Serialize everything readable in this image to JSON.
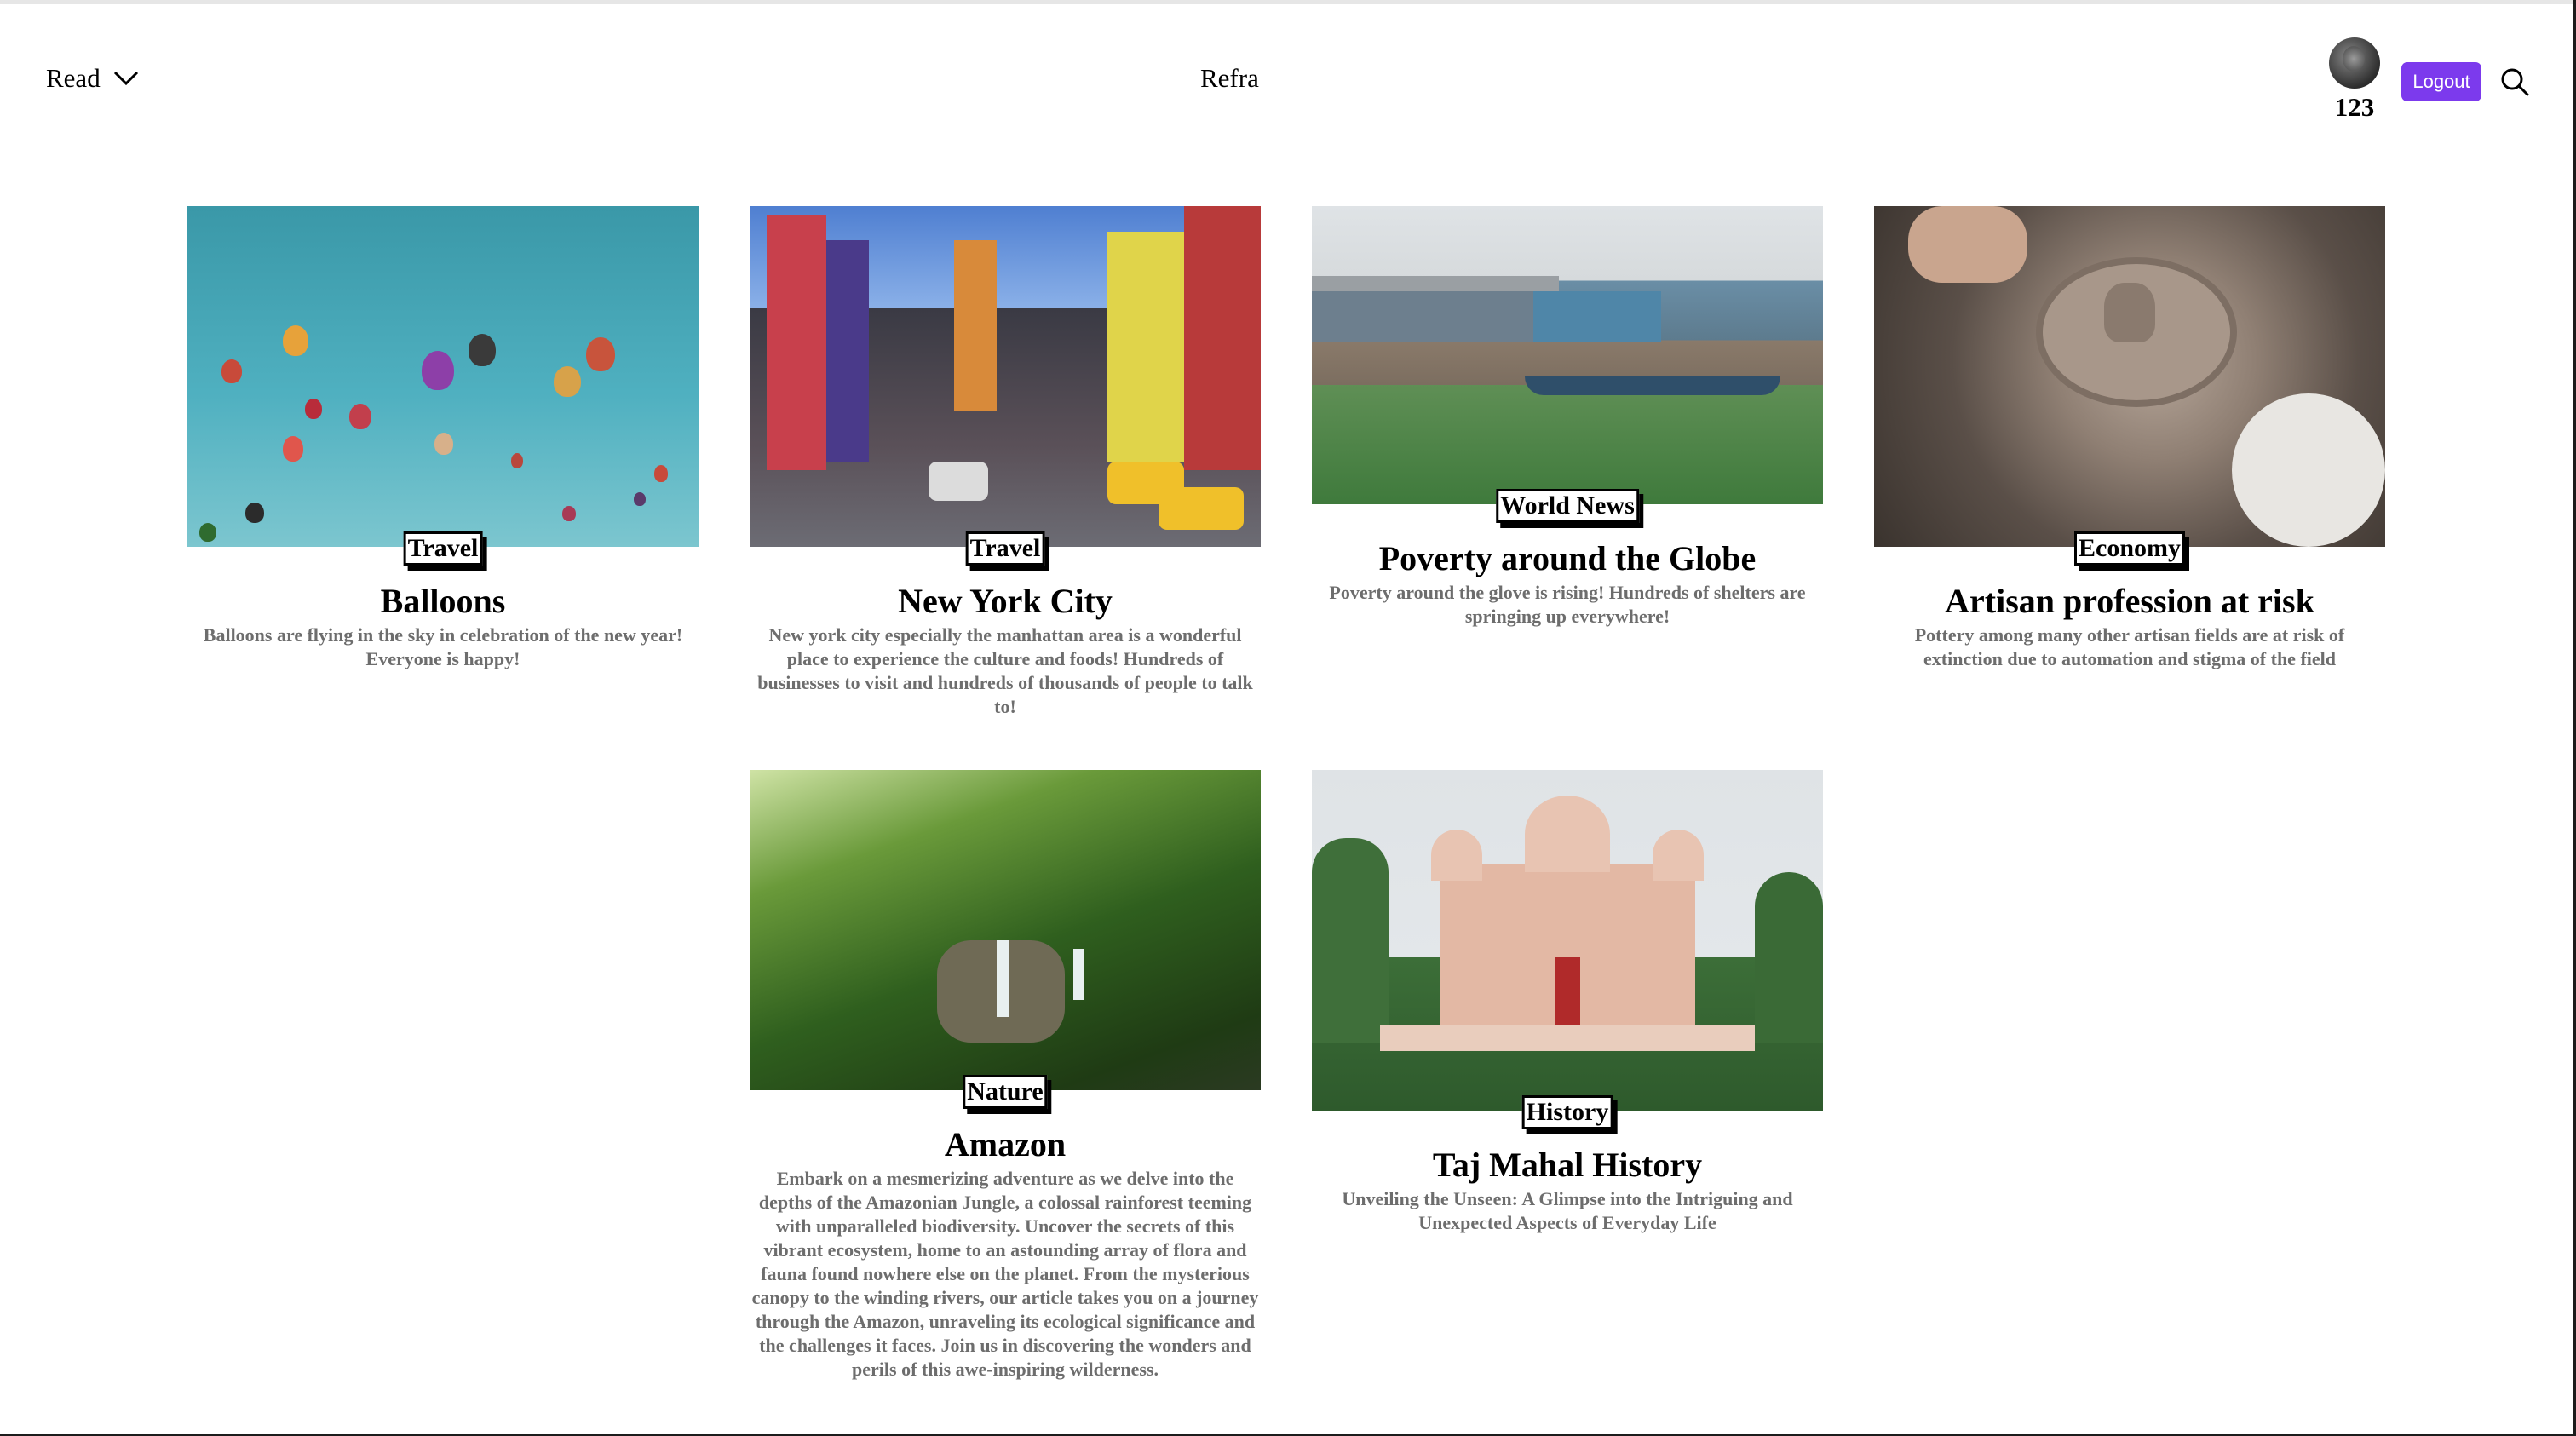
{
  "header": {
    "read_label": "Read",
    "brand": "Refra",
    "username": "123",
    "logout_label": "Logout"
  },
  "articles": [
    {
      "category": "Travel",
      "title": "Balloons",
      "description": "Balloons are flying in the sky in celebration of the new year! Everyone is happy!"
    },
    {
      "category": "Travel",
      "title": "New York City",
      "description": "New york city especially the manhattan area is a wonderful place to experience the culture and foods! Hundreds of businesses to visit and hundreds of thousands of people to talk to!"
    },
    {
      "category": "World News",
      "title": "Poverty around the Globe",
      "description": "Poverty around the glove is rising! Hundreds of shelters are springing up everywhere!"
    },
    {
      "category": "Economy",
      "title": "Artisan profession at risk",
      "description": "Pottery among many other artisan fields are at risk of extinction due to automation and stigma of the field"
    },
    {
      "category": "Nature",
      "title": "Amazon",
      "description": "Embark on a mesmerizing adventure as we delve into the depths of the Amazonian Jungle, a colossal rainforest teeming with unparalleled biodiversity. Uncover the secrets of this vibrant ecosystem, home to an astounding array of flora and fauna found nowhere else on the planet. From the mysterious canopy to the winding rivers, our article takes you on a journey through the Amazon, unraveling its ecological significance and the challenges it faces. Join us in discovering the wonders and perils of this awe-inspiring wilderness."
    },
    {
      "category": "History",
      "title": "Taj Mahal History",
      "description": "Unveiling the Unseen: A Glimpse into the Intriguing and Unexpected Aspects of Everyday Life"
    }
  ],
  "colors": {
    "accent": "#7c3aed",
    "description_text": "#6d6d6d"
  },
  "icons": [
    "chevron-down-icon",
    "search-icon",
    "avatar"
  ]
}
